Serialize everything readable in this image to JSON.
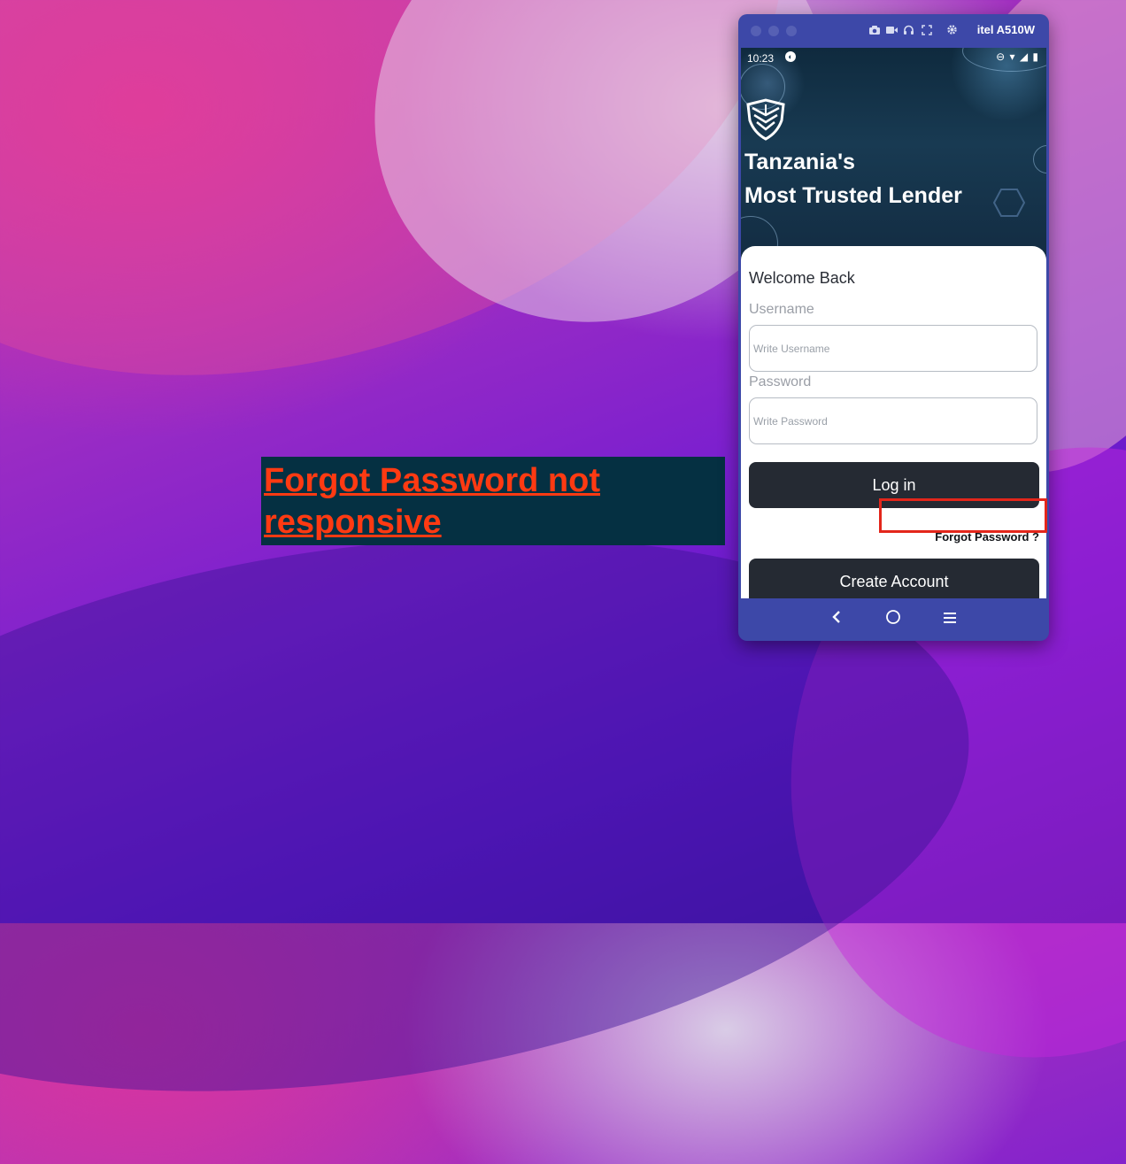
{
  "annotation": {
    "text": "Forgot Password not responsive",
    "color": "#ff3a12",
    "background": "#053042"
  },
  "emulator": {
    "device_name": "itel A510W",
    "toolbar_icons": [
      "camera-icon",
      "video-icon",
      "headphones-icon",
      "fullscreen-icon",
      "gear-icon"
    ]
  },
  "status_bar": {
    "time": "10:23"
  },
  "hero": {
    "title_line1": "Tanzania's",
    "title_line2": "Most Trusted Lender"
  },
  "login": {
    "heading": "Welcome Back",
    "username_label": "Username",
    "username_placeholder": "Write Username",
    "password_label": "Password",
    "password_placeholder": "Write Password",
    "login_button": "Log in",
    "forgot_link": "Forgot Password ?",
    "create_account_button": "Create Account"
  },
  "nav": {
    "back": "‹",
    "home": "○",
    "menu": "≡"
  },
  "colors": {
    "button_dark": "#252a33",
    "emulator_frame": "#3d48a8",
    "highlight_border": "#e3261b"
  }
}
